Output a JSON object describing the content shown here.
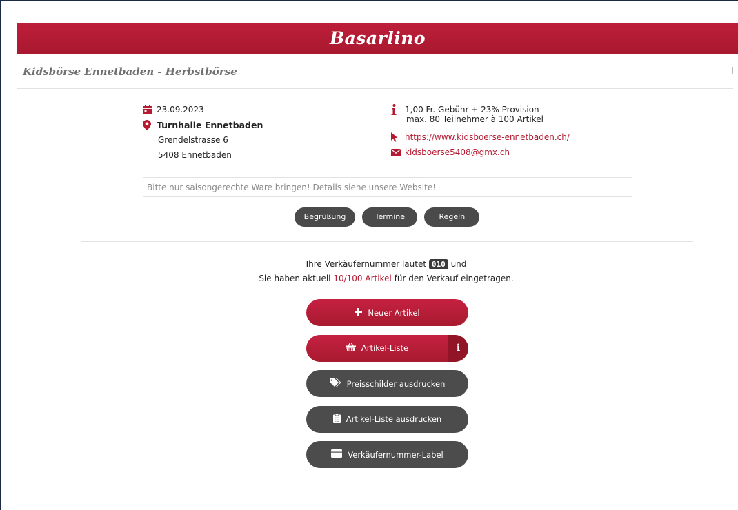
{
  "brand": {
    "name": "Basarlino"
  },
  "event": {
    "title": "Kidsbörse Ennetbaden - Herbstbörse",
    "date": "23.09.2023",
    "venue": "Turnhalle Ennetbaden",
    "street": "Grendelstrasse 6",
    "city": "5408 Ennetbaden",
    "fees": "1,00 Fr. Gebühr + 23% Provision",
    "capacity": "max. 80 Teilnehmer à 100 Artikel",
    "website": "https://www.kidsboerse-ennetbaden.ch/",
    "email": "kidsboerse5408@gmx.ch",
    "notice": "Bitte nur saisongerechte Ware bringen! Details siehe unsere Website!"
  },
  "tabs": [
    {
      "label": "Begrüßung"
    },
    {
      "label": "Termine"
    },
    {
      "label": "Regeln"
    }
  ],
  "summary": {
    "line1_prefix": "Ihre Verkäufernummer lautet",
    "seller_number": "010",
    "line1_suffix": "und",
    "line2_prefix": "Sie haben aktuell",
    "articles_link": "10/100 Artikel",
    "line2_suffix": "für den Verkauf eingetragen."
  },
  "actions": {
    "new_article": "Neuer Artikel",
    "article_list": "Artikel-Liste",
    "article_list_info": "i",
    "print_tags": "Preisschilder ausdrucken",
    "print_list": "Artikel-Liste ausdrucken",
    "seller_label": "Verkäufernummer-Label"
  },
  "colors": {
    "brand": "#b41b32",
    "dark_button": "#4c4c4c"
  }
}
